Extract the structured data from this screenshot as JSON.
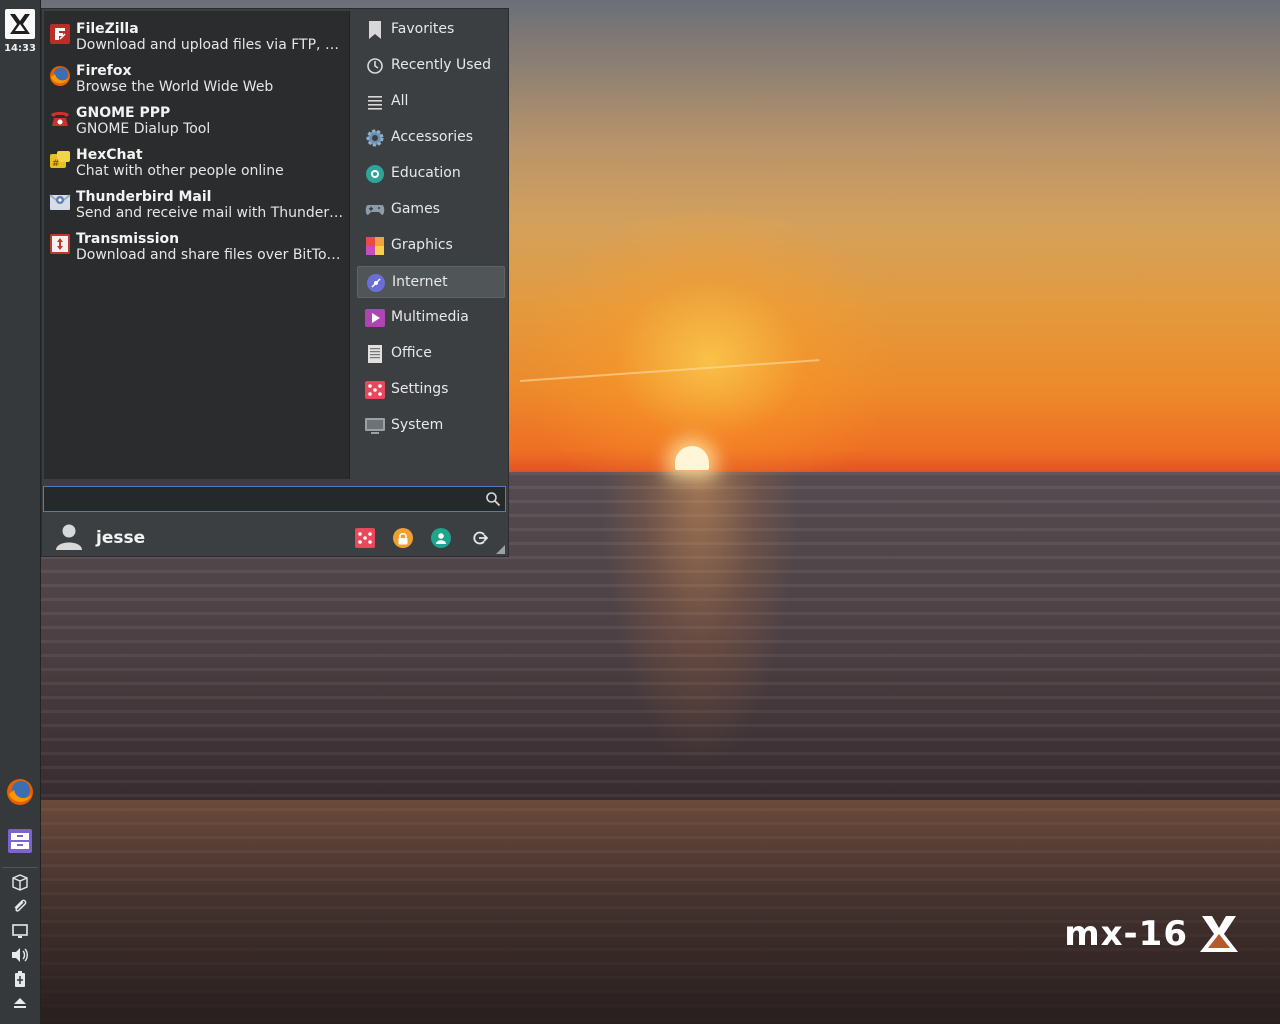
{
  "panel": {
    "clock": "14:33",
    "launchers": [
      "firefox-icon",
      "file-manager-icon"
    ],
    "tray": [
      "package-installer-icon",
      "clipboard-icon",
      "display-icon",
      "volume-icon",
      "battery-icon",
      "eject-icon"
    ]
  },
  "menu": {
    "apps": [
      {
        "name": "FileZilla",
        "desc": "Download and upload files via FTP, FTPS ...",
        "icon": "filezilla-icon",
        "color": "#bf2b26"
      },
      {
        "name": "Firefox",
        "desc": "Browse the World Wide Web",
        "icon": "firefox-icon",
        "color": "#e66000"
      },
      {
        "name": "GNOME PPP",
        "desc": "GNOME Dialup Tool",
        "icon": "telephone-icon",
        "color": "#d0302a"
      },
      {
        "name": "HexChat",
        "desc": "Chat with other people online",
        "icon": "hexchat-icon",
        "color": "#e8c21a"
      },
      {
        "name": "Thunderbird Mail",
        "desc": "Send and receive mail with Thunderbird",
        "icon": "thunderbird-icon",
        "color": "#8fa6c8"
      },
      {
        "name": "Transmission",
        "desc": "Download and share files over BitTorrent",
        "icon": "transmission-icon",
        "color": "#c0392b"
      }
    ],
    "categories": [
      {
        "label": "Favorites",
        "icon": "bookmark-icon"
      },
      {
        "label": "Recently Used",
        "icon": "clock-icon"
      },
      {
        "label": "All",
        "icon": "list-icon"
      },
      {
        "label": "Accessories",
        "icon": "gear-icon"
      },
      {
        "label": "Education",
        "icon": "education-icon"
      },
      {
        "label": "Games",
        "icon": "gamepad-icon"
      },
      {
        "label": "Graphics",
        "icon": "palette-icon"
      },
      {
        "label": "Internet",
        "icon": "globe-icon",
        "active": true
      },
      {
        "label": "Multimedia",
        "icon": "play-icon"
      },
      {
        "label": "Office",
        "icon": "document-icon"
      },
      {
        "label": "Settings",
        "icon": "settings-icon"
      },
      {
        "label": "System",
        "icon": "system-icon"
      }
    ],
    "search": {
      "value": "",
      "placeholder": ""
    },
    "user": {
      "name": "jesse"
    },
    "actions": [
      "settings-manager",
      "lock-screen",
      "switch-user",
      "log-out"
    ]
  },
  "desktop": {
    "logo_text": "mx-16"
  },
  "colors": {
    "menu_bg": "#3b3f42",
    "app_list_bg": "#2a2c2d",
    "panel_bg": "#35393c",
    "accent_blue": "#4f7fb0"
  }
}
